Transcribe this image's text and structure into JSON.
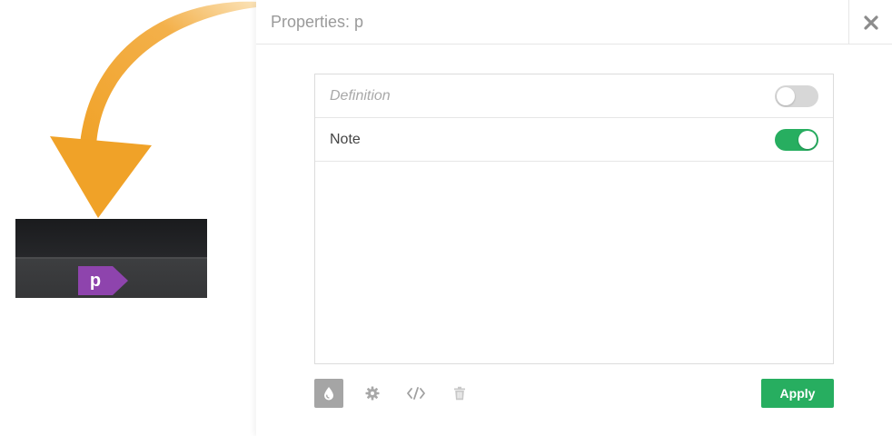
{
  "illustration": {
    "tag_label": "p",
    "arrow_color": "#f0a228",
    "tag_color": "#8e44ad"
  },
  "panel": {
    "title": "Properties: p",
    "close_icon": "close-icon"
  },
  "options": [
    {
      "label": "Definition",
      "enabled": false
    },
    {
      "label": "Note",
      "enabled": true
    }
  ],
  "toolbar": {
    "icons": [
      "style-drop-icon",
      "gear-icon",
      "code-icon",
      "trash-icon"
    ],
    "apply_label": "Apply"
  },
  "colors": {
    "accent_green": "#27ae60",
    "toggle_off": "#d7d7d7"
  }
}
